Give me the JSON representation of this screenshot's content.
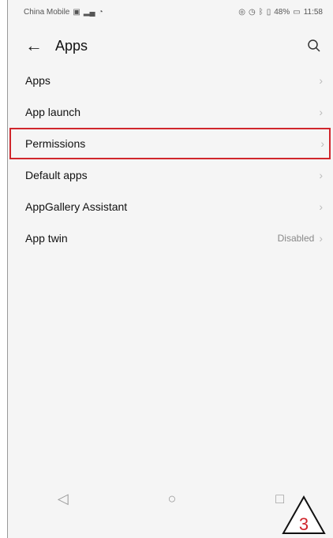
{
  "status_bar": {
    "carrier": "China Mobile",
    "right_text": "48%",
    "time": "11:58"
  },
  "header": {
    "title": "Apps"
  },
  "items": [
    {
      "label": "Apps"
    },
    {
      "label": "App launch"
    },
    {
      "label": "Permissions",
      "highlighted": true
    },
    {
      "label": "Default apps"
    },
    {
      "label": "AppGallery Assistant"
    },
    {
      "label": "App twin",
      "value": "Disabled"
    }
  ],
  "annotation": {
    "step_number": "3"
  },
  "colors": {
    "highlight": "#d0262c",
    "step_number": "#d0262c"
  }
}
